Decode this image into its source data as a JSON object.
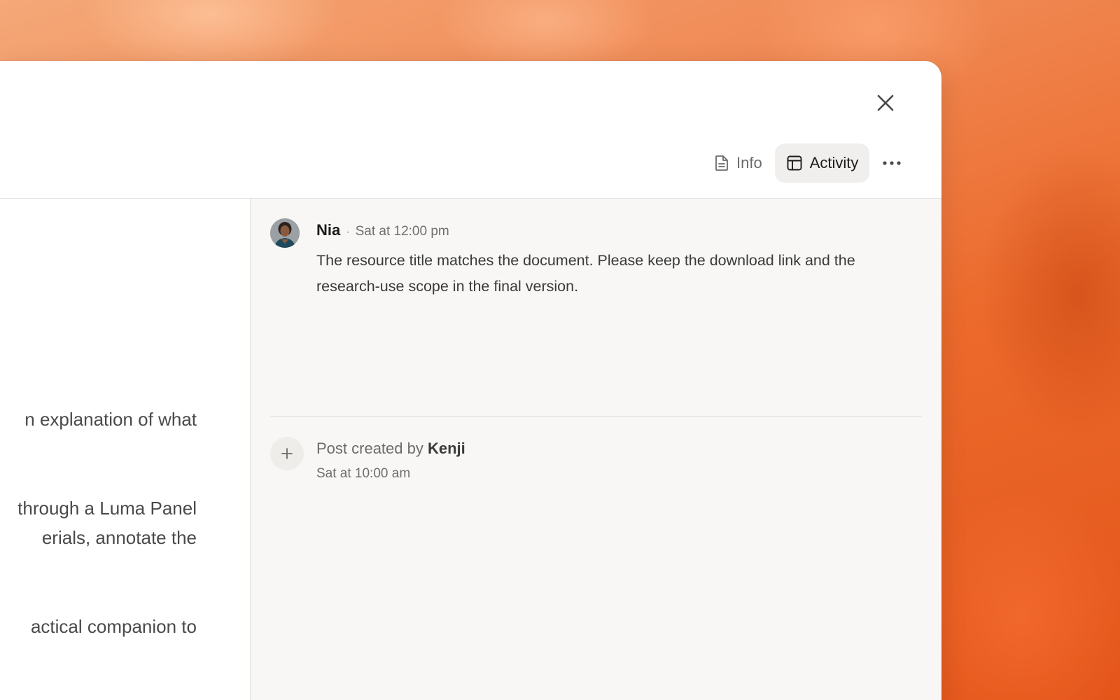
{
  "header": {
    "tabs": [
      {
        "label": "Info",
        "icon": "document-icon",
        "active": false
      },
      {
        "label": "Activity",
        "icon": "layout-panel-icon",
        "active": true
      }
    ],
    "close_icon": "close-icon",
    "more_icon": "more-horizontal-icon"
  },
  "document": {
    "lines": [
      "n explanation of what",
      "through a Luma Panel",
      "erials, annotate the",
      "actical companion to"
    ]
  },
  "activity": {
    "comment": {
      "author": "Nia",
      "separator": "·",
      "time": "Sat at 12:00 pm",
      "body": "The resource title matches the document. Please keep the download link and the research-use scope in the final version."
    },
    "event": {
      "prefix": "Post created by",
      "actor": "Kenji",
      "time": "Sat at 10:00 am",
      "icon": "plus-icon"
    }
  },
  "colors": {
    "accent_background": "#ec6a2c",
    "window": "#ffffff",
    "activity_pane": "#f8f7f5",
    "active_tab": "#f0efed"
  }
}
